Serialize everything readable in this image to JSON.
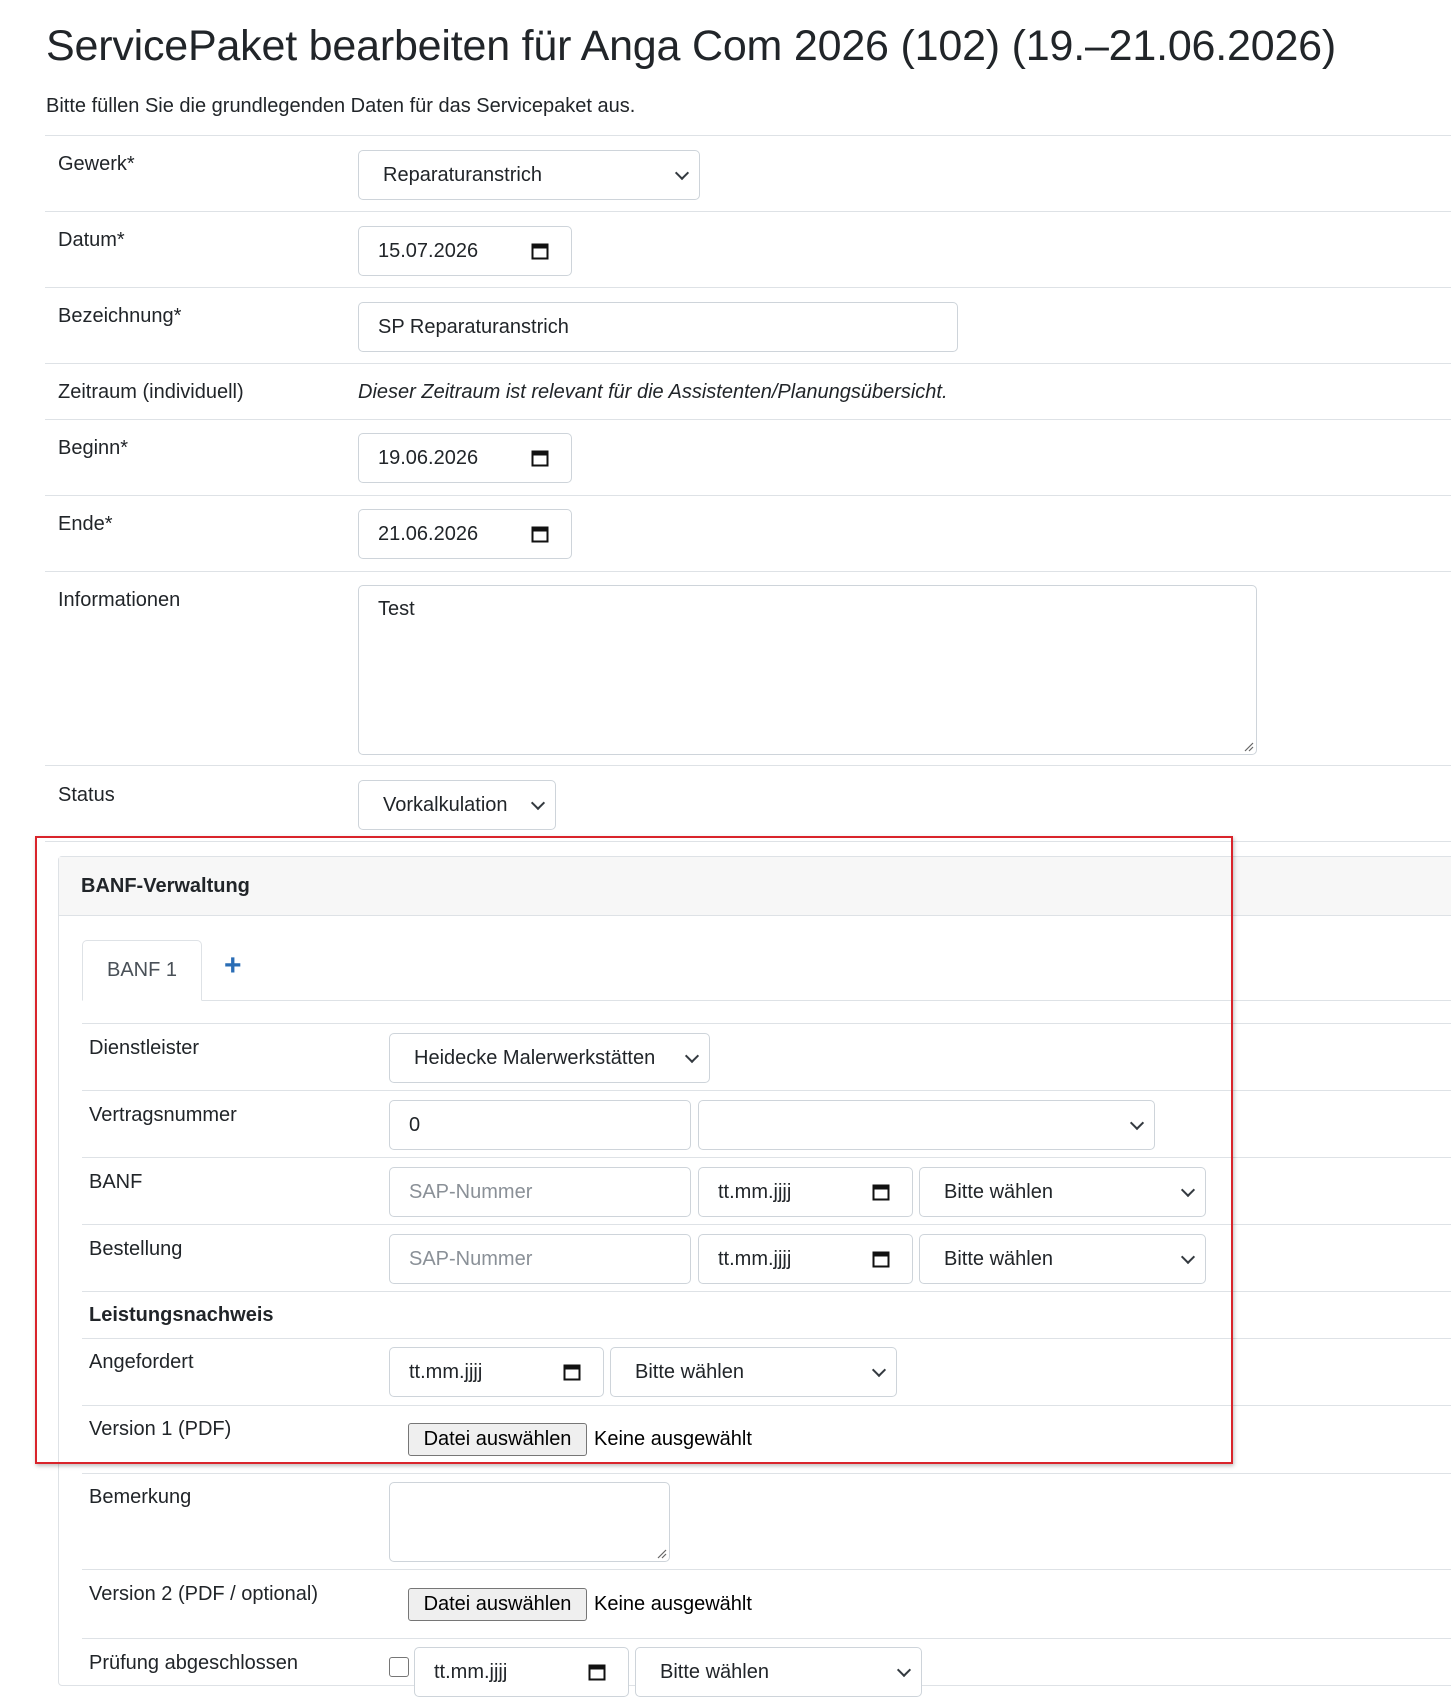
{
  "page": {
    "title": "ServicePaket bearbeiten für Anga Com 2026 (102) (19.–21.06.2026)",
    "subtitle": "Bitte füllen Sie die grundlegenden Daten für das Servicepaket aus."
  },
  "form": {
    "gewerk": {
      "label": "Gewerk*",
      "value": "Reparaturanstrich"
    },
    "datum": {
      "label": "Datum*",
      "value": "15.07.2026"
    },
    "bezeichnung": {
      "label": "Bezeichnung*",
      "value": "SP Reparaturanstrich"
    },
    "zeitraum": {
      "label": "Zeitraum (individuell)",
      "note": "Dieser Zeitraum ist relevant für die Assistenten/Planungsübersicht."
    },
    "beginn": {
      "label": "Beginn*",
      "value": "19.06.2026"
    },
    "ende": {
      "label": "Ende*",
      "value": "21.06.2026"
    },
    "informationen": {
      "label": "Informationen",
      "value": "Test"
    },
    "status": {
      "label": "Status",
      "value": "Vorkalkulation"
    }
  },
  "banf": {
    "panel_title": "BANF-Verwaltung",
    "tabs": [
      {
        "label": "BANF 1"
      }
    ],
    "add_tab_symbol": "+",
    "dienstleister": {
      "label": "Dienstleister",
      "value": "Heidecke Malerwerkstätten"
    },
    "vertragsnummer": {
      "label": "Vertragsnummer",
      "value": "0",
      "select_value": ""
    },
    "banf_row": {
      "label": "BANF",
      "sap_placeholder": "SAP-Nummer",
      "date_placeholder": "tt.mm.jjjj",
      "select_value": "Bitte wählen"
    },
    "bestellung": {
      "label": "Bestellung",
      "sap_placeholder": "SAP-Nummer",
      "date_placeholder": "tt.mm.jjjj",
      "select_value": "Bitte wählen"
    },
    "leistungsnachweis": {
      "heading": "Leistungsnachweis"
    },
    "angefordert": {
      "label": "Angefordert",
      "date_placeholder": "tt.mm.jjjj",
      "select_value": "Bitte wählen"
    },
    "version1": {
      "label": "Version 1 (PDF)",
      "button": "Datei auswählen",
      "status": "Keine ausgewählt"
    },
    "bemerkung": {
      "label": "Bemerkung",
      "value": ""
    },
    "version2": {
      "label": "Version 2 (PDF / optional)",
      "button": "Datei auswählen",
      "status": "Keine ausgewählt"
    },
    "pruefung": {
      "label": "Prüfung abgeschlossen",
      "date_placeholder": "tt.mm.jjjj",
      "select_value": "Bitte wählen"
    }
  },
  "colors": {
    "highlight_border": "#d9242b",
    "accent": "#2a6db5",
    "border": "#ced4da",
    "divider": "#dee2e6"
  }
}
